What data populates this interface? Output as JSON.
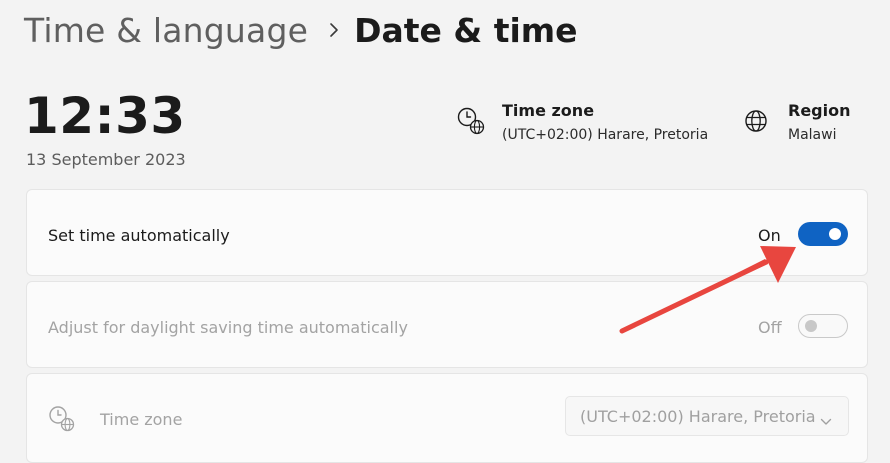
{
  "breadcrumb": {
    "parent": "Time & language",
    "current": "Date & time"
  },
  "clock": {
    "time": "12:33",
    "date": "13 September 2023"
  },
  "time_zone_info": {
    "title": "Time zone",
    "value": "(UTC+02:00) Harare, Pretoria",
    "icon": "clock-globe-icon"
  },
  "region_info": {
    "title": "Region",
    "value": "Malawi",
    "icon": "globe-icon"
  },
  "settings": {
    "set_time_auto": {
      "label": "Set time automatically",
      "state_label": "On",
      "enabled": true
    },
    "daylight_saving": {
      "label": "Adjust for daylight saving time automatically",
      "state_label": "Off",
      "enabled": false
    },
    "time_zone": {
      "label": "Time zone",
      "selected": "(UTC+02:00) Harare, Pretoria",
      "icon": "clock-globe-icon"
    }
  },
  "colors": {
    "accent": "#0f63c3",
    "annotation_arrow": "#e8463f",
    "background": "#f3f3f3"
  }
}
